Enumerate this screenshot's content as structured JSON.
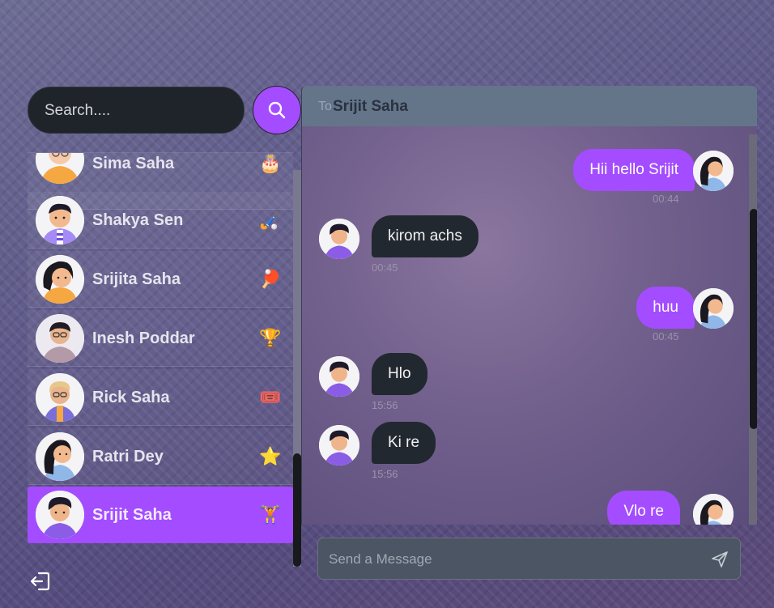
{
  "search": {
    "placeholder": "Search...."
  },
  "contacts": [
    {
      "name": "Sima Saha",
      "emoji": "🎂",
      "emoji_name": "birthday-cake-icon"
    },
    {
      "name": "Shakya Sen",
      "emoji": "🏑",
      "emoji_name": "hockey-stick-icon"
    },
    {
      "name": "Srijita Saha",
      "emoji": "🏓",
      "emoji_name": "ping-pong-icon"
    },
    {
      "name": "Inesh Poddar",
      "emoji": "🏆",
      "emoji_name": "trophy-icon"
    },
    {
      "name": "Rick Saha",
      "emoji": "🎟️",
      "emoji_name": "ticket-icon"
    },
    {
      "name": "Ratri Dey",
      "emoji": "⭐",
      "emoji_name": "star-icon"
    },
    {
      "name": "Srijit Saha",
      "emoji": "🏋️",
      "emoji_name": "weightlifter-icon",
      "active": true
    }
  ],
  "chat": {
    "to_label": "To",
    "recipient": "Srijit Saha",
    "messages": [
      {
        "direction": "out",
        "text": "Hii hello Srijit",
        "time": "00:44"
      },
      {
        "direction": "in",
        "text": "kirom achs",
        "time": "00:45"
      },
      {
        "direction": "out",
        "text": "huu",
        "time": "00:45"
      },
      {
        "direction": "in",
        "text": "Hlo",
        "time": "15:56"
      },
      {
        "direction": "in",
        "text": "Ki re",
        "time": "15:56"
      },
      {
        "direction": "out",
        "text": "Vlo re",
        "time": ""
      }
    ],
    "composer_placeholder": "Send a Message"
  },
  "colors": {
    "accent": "#a44cff",
    "incoming_bubble": "#22282f",
    "header": "#64758a"
  }
}
